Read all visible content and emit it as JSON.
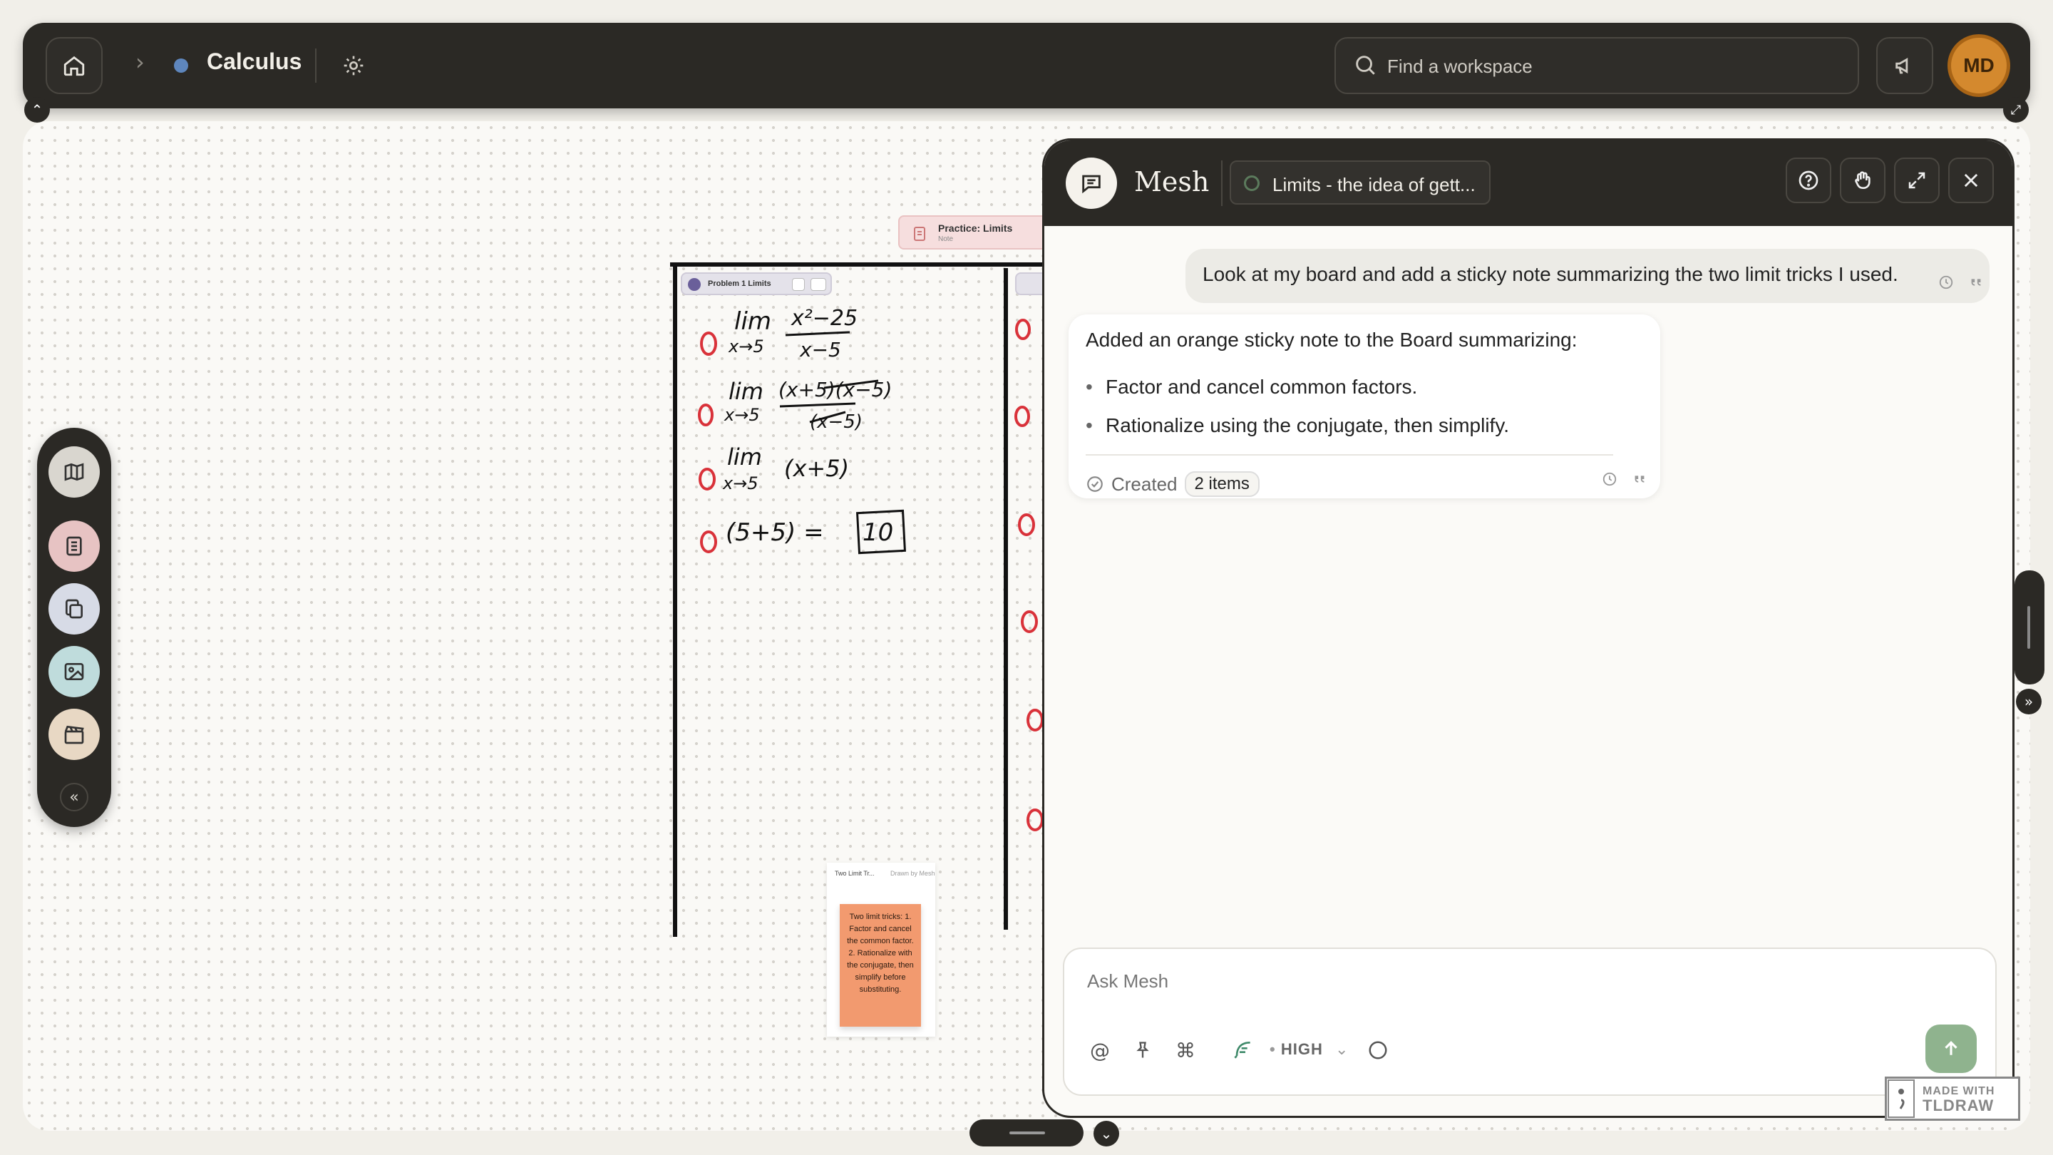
{
  "topbar": {
    "breadcrumb_separator": "›",
    "workspace_title": "Calculus",
    "search_placeholder": "Find a workspace",
    "avatar_initials": "MD"
  },
  "canvas": {
    "note_card": {
      "title": "Practice: Limits",
      "subtitle": "Note"
    },
    "problem_chip": "Problem 1 Limits",
    "sticky_header": "Two Limit Tr...",
    "sticky_header_right": "Drawn by Mesh",
    "sticky_text": "Two limit tricks: 1. Factor and cancel the common factor. 2. Rationalize with the conjugate, then simplify before substituting.",
    "handwriting": {
      "line1_lim": "lim",
      "line1_sub": "x→5",
      "line1_num": "x²−25",
      "line1_den": "x−5",
      "line2_lim": "lim",
      "line2_sub": "x→5",
      "line2_num": "(x+5)(x−5)",
      "line2_den": "(x−5)",
      "line3_lim": "lim",
      "line3_sub": "x→5",
      "line3_expr": "(x+5)",
      "line4_expr": "(5+5) =",
      "line4_ans": "10"
    }
  },
  "toolbar": {
    "tools": [
      "map-icon",
      "notebook-icon",
      "copy-icon",
      "image-icon",
      "clapperboard-icon"
    ],
    "colors": [
      "#d9d6cf",
      "#e7c3c3",
      "#d7dbe6",
      "#bfdcdc",
      "#e8d8c4"
    ],
    "collapse_glyph": "«"
  },
  "chat": {
    "title": "Mesh",
    "context_chip": "Limits - the idea of gett...",
    "user_message": "Look at my board and add a sticky note summarizing the two limit tricks I used.",
    "bot_intro": "Added an orange sticky note to the Board summarizing:",
    "bot_bullets": [
      "Factor and cancel common factors.",
      "Rationalize using the conjugate, then simplify."
    ],
    "created_label": "Created",
    "created_badge": "2 items",
    "composer_placeholder": "Ask Mesh",
    "effort_label": "HIGH",
    "accent_send": "#8fb38e"
  },
  "watermark": {
    "line1": "MADE WITH",
    "line2": "TLDRAW"
  }
}
